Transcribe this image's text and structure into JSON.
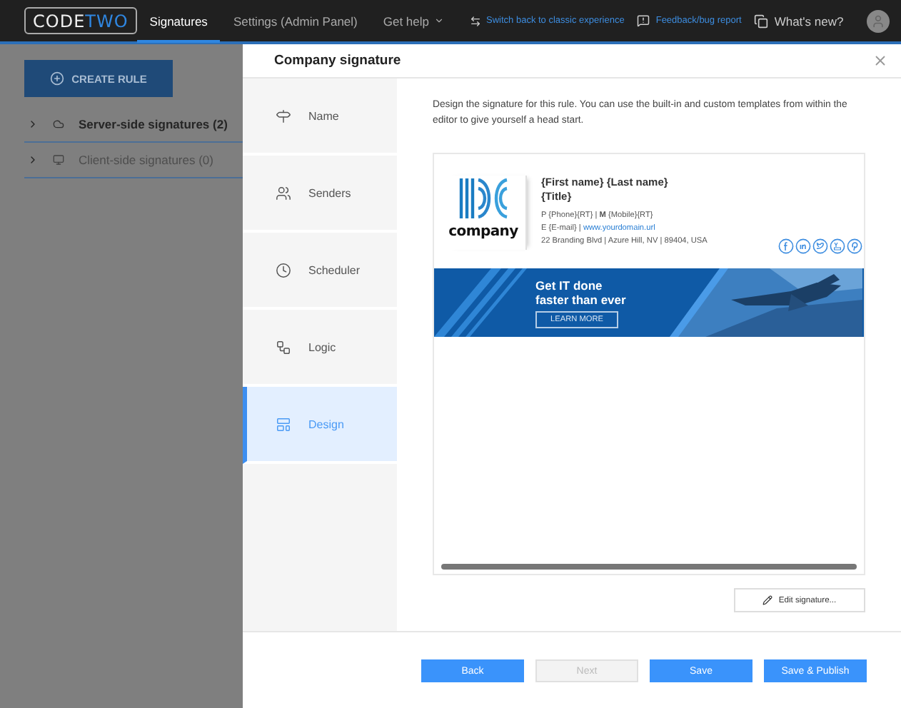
{
  "top_bar": {
    "logo": {
      "left": "CODE",
      "right": "TWO"
    },
    "nav": [
      {
        "label": "Signatures",
        "selected": true,
        "kind": "link"
      },
      {
        "label": "Settings (Admin Panel)",
        "selected": false,
        "kind": "link"
      },
      {
        "label": "Get help",
        "selected": false,
        "kind": "dropdown"
      }
    ],
    "actions": [
      {
        "label": "Switch back to classic experience",
        "kind": "switch"
      },
      {
        "label": "Feedback/bug report",
        "kind": "feedback"
      },
      {
        "label": "What's new?",
        "kind": "news"
      }
    ]
  },
  "background": {
    "create_rule": "CREATE RULE",
    "tree": [
      {
        "label": "Server-side signatures (2)",
        "kind": "server"
      },
      {
        "label": "Client-side signatures (0)",
        "kind": "client"
      }
    ]
  },
  "modal": {
    "title": "Company signature",
    "steps": [
      {
        "label": "Name",
        "kind": "name",
        "selected": false
      },
      {
        "label": "Senders",
        "kind": "senders",
        "selected": false
      },
      {
        "label": "Scheduler",
        "kind": "scheduler",
        "selected": false
      },
      {
        "label": "Logic",
        "kind": "logic",
        "selected": false
      },
      {
        "label": "Design",
        "kind": "design",
        "selected": true
      }
    ],
    "description": "Design the signature for this rule. You can use the built-in and custom templates from within the editor to give yourself a head start.",
    "signature": {
      "logo_text": "company",
      "name": "{First name} {Last name}",
      "title": "{Title}",
      "phone_line": "P {Phone}{RT} | **M** {Mobile}{RT}",
      "email_prefix": "E {E-mail} |",
      "website": "www.yourdomain.url",
      "address": "22 Branding Blvd | Azure Hill, NV | 89404, USA",
      "banner": {
        "headline": [
          "Get IT done",
          "faster than ever"
        ],
        "button": "LEARN MORE"
      }
    },
    "edit_button": "Edit signature...",
    "buttons": [
      {
        "label": "Back",
        "disabled": false
      },
      {
        "label": "Next",
        "disabled": true
      },
      {
        "label": "Save",
        "disabled": false
      },
      {
        "label": "Save & Publish",
        "disabled": false
      }
    ]
  }
}
